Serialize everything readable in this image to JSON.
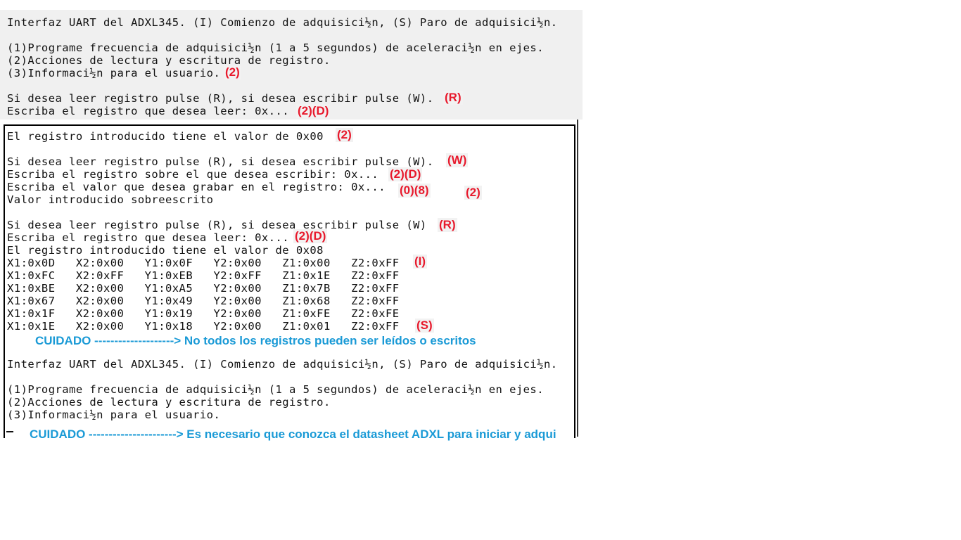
{
  "terminal_lines": [
    "Interfaz UART del ADXL345. (I) Comienzo de adquisici½n, (S) Paro de adquisici½n.",
    "(1)Programe frecuencia de adquisici½n (1 a 5 segundos) de aceleraci½n en ejes.",
    "(2)Acciones de lectura y escritura de registro.",
    "(3)Informaci½n para el usuario.",
    "Si desea leer registro pulse (R), si desea escribir pulse (W).",
    "Escriba el registro que desea leer: 0x...",
    "El registro introducido tiene el valor de 0x00",
    "Si desea leer registro pulse (R), si desea escribir pulse (W).",
    "Escriba el registro sobre el que desea escribir: 0x...",
    "Escriba el valor que desea grabar en el registro: 0x...",
    "Valor introducido sobreescrito",
    "Si desea leer registro pulse (R), si desea escribir pulse (W)",
    "Escriba el registro que desea leer: 0x...",
    "El registro introducido tiene el valor de 0x08",
    "X1:0x0D   X2:0x00   Y1:0x0F   Y2:0x00   Z1:0x00   Z2:0xFF",
    "X1:0xFC   X2:0xFF   Y1:0xEB   Y2:0xFF   Z1:0x1E   Z2:0xFF",
    "X1:0xBE   X2:0x00   Y1:0xA5   Y2:0x00   Z1:0x7B   Z2:0xFF",
    "X1:0x67   X2:0x00   Y1:0x49   Y2:0x00   Z1:0x68   Z2:0xFF",
    "X1:0x1F   X2:0x00   Y1:0x19   Y2:0x00   Z1:0xFE   Z2:0xFE",
    "X1:0x1E   X2:0x00   Y1:0x18   Y2:0x00   Z1:0x01   Z2:0xFF",
    "Interfaz UART del ADXL345. (I) Comienzo de adquisici½n, (S) Paro de adquisici½n.",
    "(1)Programe frecuencia de adquisici½n (1 a 5 segundos) de aceleraci½n en ejes.",
    "(2)Acciones de lectura y escritura de registro.",
    "(3)Informaci½n para el usuario."
  ],
  "annotations": [
    "(2)",
    "(R)",
    "(2)(D)",
    "(2)",
    "(W)",
    "(2)(D)",
    "(0)(8)",
    "(2)",
    "(R)",
    "(2)(D)",
    "(I)",
    "(S)"
  ],
  "warnings": {
    "first": "CUIDADO --------------------> No todos los registros pueden ser leídos o escritos",
    "second": "CUIDADO ----------------------> Es necesario que conozca el datasheet ADXL para iniciar y adqui"
  },
  "colors": {
    "annotation": "#e8192c",
    "warning": "#1a9ad6",
    "terminal_text": "#111111"
  }
}
